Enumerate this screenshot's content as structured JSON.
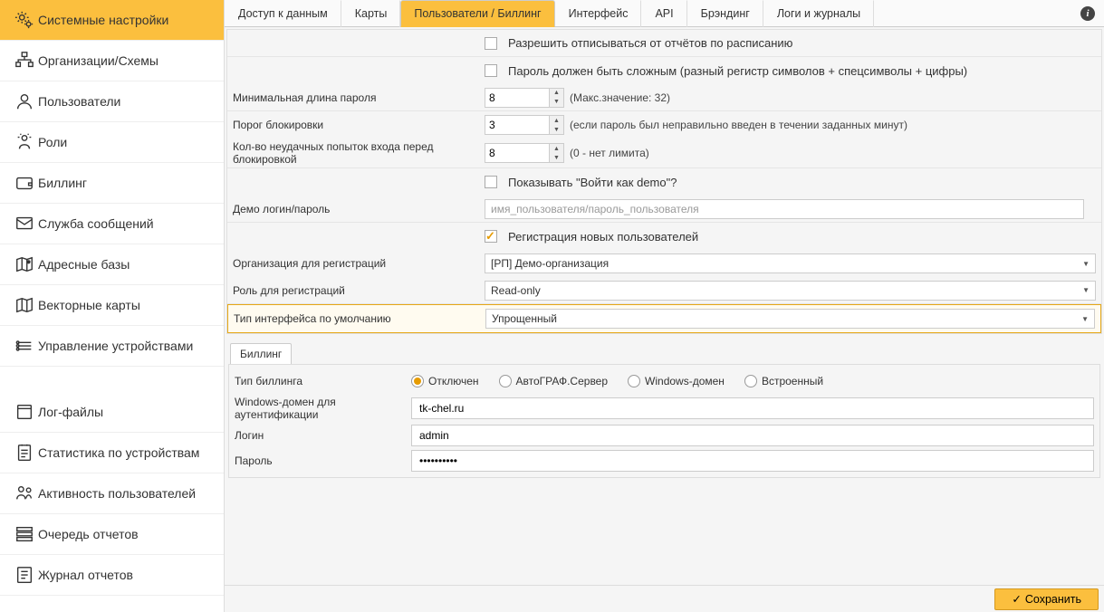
{
  "sidebar": {
    "items": [
      {
        "label": "Системные настройки",
        "icon": "gears-icon"
      },
      {
        "label": "Организации/Схемы",
        "icon": "org-icon"
      },
      {
        "label": "Пользователи",
        "icon": "user-icon"
      },
      {
        "label": "Роли",
        "icon": "roles-icon"
      },
      {
        "label": "Биллинг",
        "icon": "wallet-icon"
      },
      {
        "label": "Служба сообщений",
        "icon": "mail-icon"
      },
      {
        "label": "Адресные базы",
        "icon": "map-pin-icon"
      },
      {
        "label": "Векторные карты",
        "icon": "vector-map-icon"
      },
      {
        "label": "Управление устройствами",
        "icon": "devices-icon"
      },
      {
        "label": "Лог-файлы",
        "icon": "log-icon"
      },
      {
        "label": "Статистика по устройствам",
        "icon": "stats-icon"
      },
      {
        "label": "Активность пользователей",
        "icon": "activity-icon"
      },
      {
        "label": "Очередь отчетов",
        "icon": "queue-icon"
      },
      {
        "label": "Журнал отчетов",
        "icon": "journal-icon"
      }
    ]
  },
  "tabs": [
    "Доступ к данным",
    "Карты",
    "Пользователи / Биллинг",
    "Интерфейс",
    "API",
    "Брэндинг",
    "Логи и журналы"
  ],
  "form": {
    "allow_unsubscribe": "Разрешить отписываться от отчётов по расписанию",
    "complex_pwd": "Пароль должен быть сложным (разный регистр символов + спецсимволы + цифры)",
    "min_pwd_len_label": "Минимальная длина пароля",
    "min_pwd_len_value": "8",
    "min_pwd_len_hint": "(Макс.значение: 32)",
    "lockout_threshold_label": "Порог блокировки",
    "lockout_threshold_value": "3",
    "lockout_threshold_hint": "(если пароль был неправильно введен в течении заданных минут)",
    "failed_attempts_label": "Кол-во неудачных попыток входа перед блокировкой",
    "failed_attempts_value": "8",
    "failed_attempts_hint": "(0 - нет лимита)",
    "show_demo_label": "Показывать \"Войти как demo\"?",
    "demo_login_label": "Демо логин/пароль",
    "demo_login_placeholder": "имя_пользователя/пароль_пользователя",
    "reg_new_users_label": "Регистрация новых пользователей",
    "reg_org_label": "Организация для регистраций",
    "reg_org_value": "[РП] Демо-организация",
    "reg_role_label": "Роль для регистраций",
    "reg_role_value": "Read-only",
    "default_iface_label": "Тип интерфейса по умолчанию",
    "default_iface_value": "Упрощенный"
  },
  "billing": {
    "tab": "Биллинг",
    "type_label": "Тип биллинга",
    "options": [
      "Отключен",
      "АвтоГРАФ.Сервер",
      "Windows-домен",
      "Встроенный"
    ],
    "selected_option": 0,
    "win_domain_label": "Windows-домен для аутентификации",
    "win_domain_value": "tk-chel.ru",
    "login_label": "Логин",
    "login_value": "admin",
    "pwd_label": "Пароль",
    "pwd_value": "••••••••••"
  },
  "save_label": "Сохранить"
}
